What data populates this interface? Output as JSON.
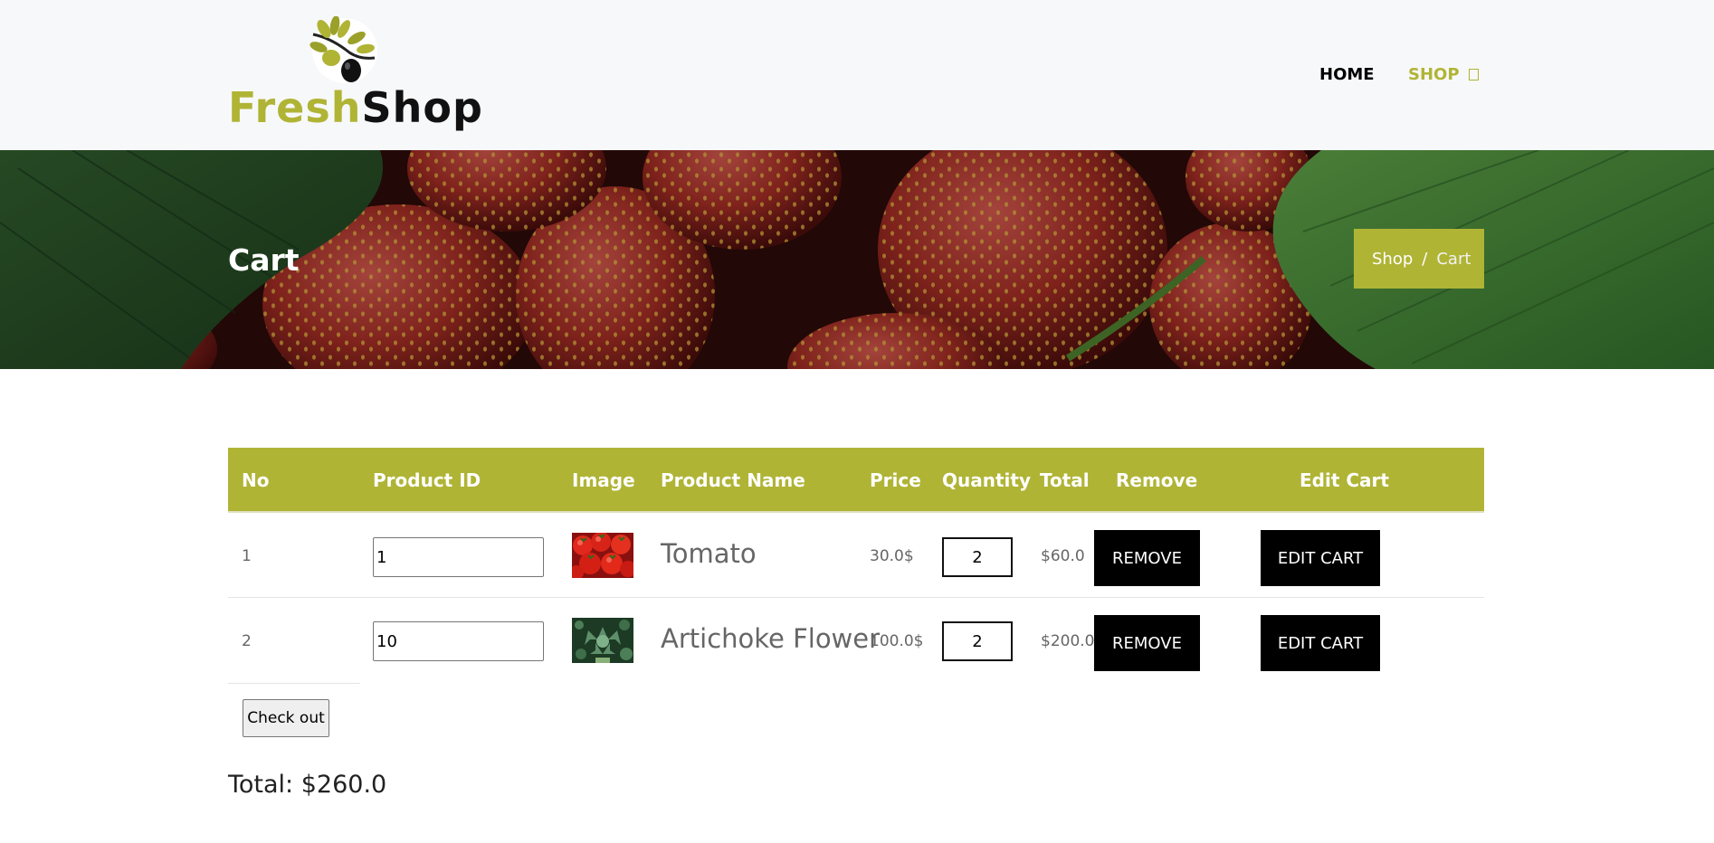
{
  "brand": {
    "fresh": "Fresh",
    "shop": "Shop"
  },
  "nav": {
    "home": "HOME",
    "shop": "SHOP"
  },
  "banner": {
    "title": "Cart",
    "breadcrumb": {
      "parent": "Shop",
      "separator": "/",
      "current": "Cart"
    }
  },
  "table": {
    "headers": {
      "no": "No",
      "product_id": "Product ID",
      "image": "Image",
      "product_name": "Product Name",
      "price": "Price",
      "quantity": "Quantity",
      "total": "Total",
      "remove": "Remove",
      "edit_cart": "Edit Cart"
    },
    "rows": [
      {
        "no": "1",
        "product_id": "1",
        "image": "tomato-image",
        "product_name": "Tomato",
        "price": "30.0$",
        "quantity": "2",
        "total": "$60.0",
        "remove_label": "REMOVE",
        "edit_label": "EDIT CART"
      },
      {
        "no": "2",
        "product_id": "10",
        "image": "artichoke-image",
        "product_name": "Artichoke Flower",
        "price": "100.0$",
        "quantity": "2",
        "total": "$200.0",
        "remove_label": "REMOVE",
        "edit_label": "EDIT CART"
      }
    ]
  },
  "checkout": {
    "label": "Check out"
  },
  "grand_total": "Total: $260.0",
  "colors": {
    "accent": "#b0b435",
    "button": "#000000",
    "header_bg": "#f7f8f9"
  }
}
